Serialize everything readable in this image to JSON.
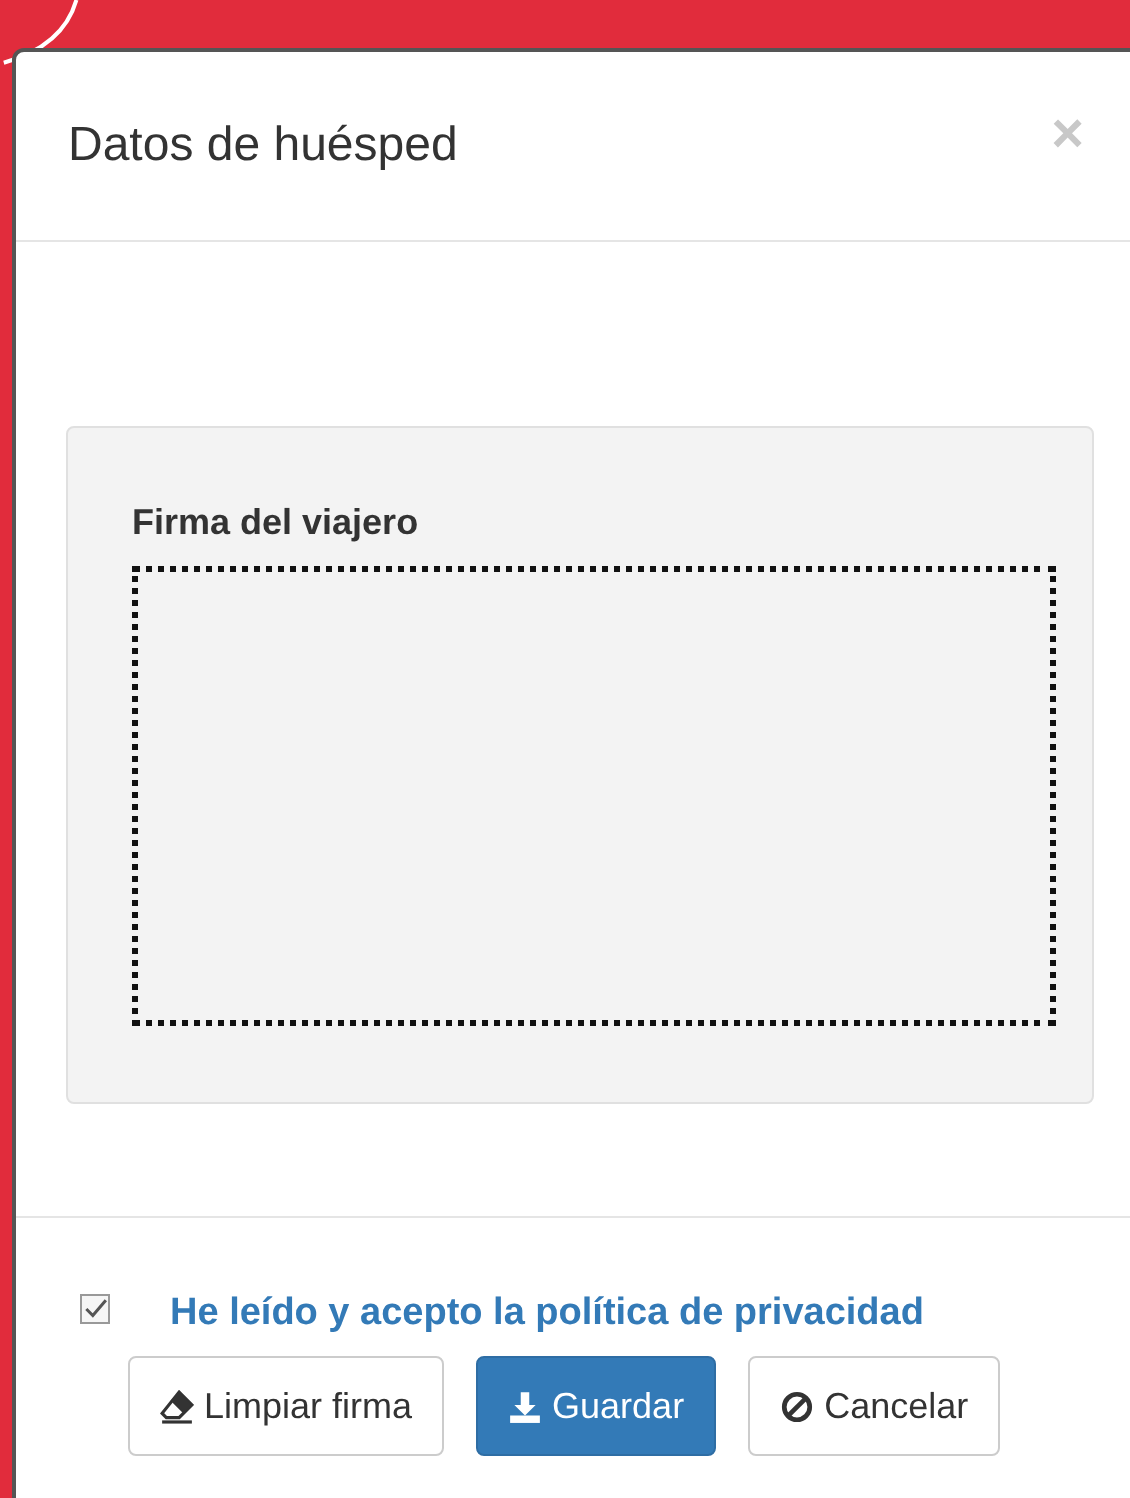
{
  "modal": {
    "title": "Datos de huésped",
    "close": "×"
  },
  "signature": {
    "label": "Firma del viajero"
  },
  "consent": {
    "checked": true,
    "text": "He leído y acepto la política de privacidad"
  },
  "buttons": [
    {
      "label": "Limpiar firma",
      "kind": "default"
    },
    {
      "label": "Guardar",
      "kind": "primary"
    },
    {
      "label": "Cancelar",
      "kind": "default"
    }
  ]
}
